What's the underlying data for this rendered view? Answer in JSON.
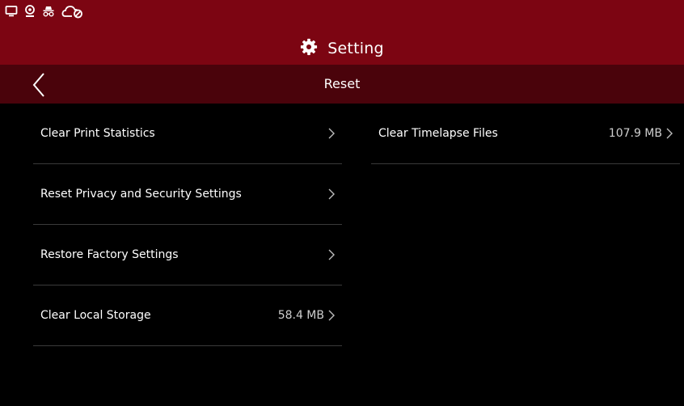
{
  "status_bar": {
    "icons": [
      "monitor-icon",
      "webcam-icon",
      "incognito-icon",
      "cloud-disconnected-icon"
    ]
  },
  "header": {
    "title": "Setting",
    "title_icon": "gear-icon"
  },
  "subheader": {
    "title": "Reset",
    "back_icon": "chevron-left-icon"
  },
  "left_list": [
    {
      "label": "Clear Print Statistics",
      "value": ""
    },
    {
      "label": "Reset Privacy and Security Settings",
      "value": ""
    },
    {
      "label": "Restore Factory Settings",
      "value": ""
    },
    {
      "label": "Clear Local Storage",
      "value": "58.4 MB"
    }
  ],
  "right_list": [
    {
      "label": "Clear Timelapse Files",
      "value": "107.9 MB"
    }
  ],
  "colors": {
    "header_bg": "#7c0512",
    "subheader_bg": "#4a030b",
    "background": "#000000",
    "divider": "#3a3a3a"
  }
}
